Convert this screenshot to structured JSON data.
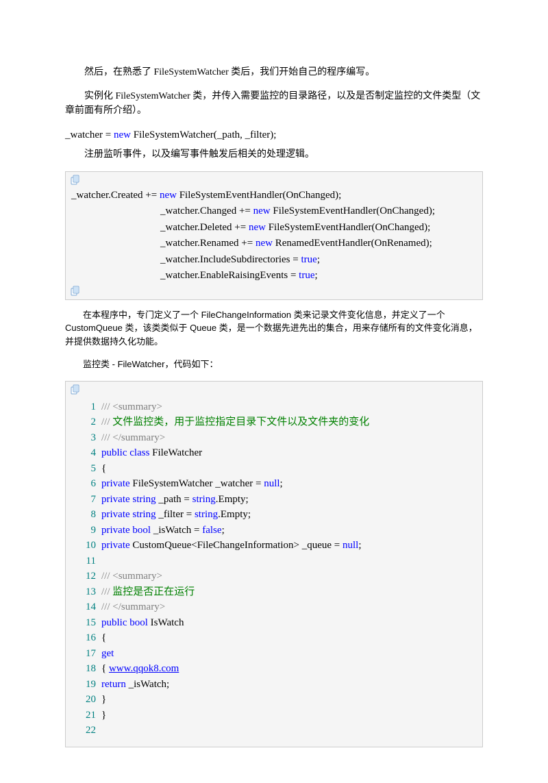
{
  "p1": "然后，在熟悉了 FileSystemWatcher 类后，我们开始自己的程序编写。",
  "p2": "实例化 FileSystemWatcher 类，并传入需要监控的目录路径，以及是否制定监控的文件类型（文章前面有所介绍）。",
  "p3": "注册监听事件，以及编写事件触发后相关的处理逻辑。",
  "p4a": "在本程序中，专门定义了一个 ",
  "p4b": " 类来记录文件变化信息，并定义了一个 ",
  "p4c": " 类，该类类似于 ",
  "p4d": " 类，是一个数据先进先出的集合，用来存储所有的文件变化消息，并提供数据持久化功能。",
  "term1": "FileChangeInformation",
  "term2": "CustomQueue",
  "term3": "Queue",
  "p5a": "监控类 - ",
  "p5b": "FileWatcher",
  "p5c": "，代码如下：",
  "code1": {
    "pre": "_watcher = ",
    "kw": "new",
    "post": " FileSystemWatcher(_path, _filter);"
  },
  "code2": {
    "l1a": "_watcher.Created += ",
    "l1b": "new",
    "l1c": " FileSystemEventHandler(OnChanged);",
    "l2a": "_watcher.Changed += ",
    "l2b": "new",
    "l2c": " FileSystemEventHandler(OnChanged);",
    "l3a": "_watcher.Deleted += ",
    "l3b": "new",
    "l3c": " FileSystemEventHandler(OnChanged);",
    "l4a": "_watcher.Renamed += ",
    "l4b": "new",
    "l4c": " RenamedEventHandler(OnRenamed);",
    "l5a": "_watcher.IncludeSubdirectories = ",
    "l5b": "true",
    "l5c": ";",
    "l6a": "_watcher.EnableRaisingEvents = ",
    "l6b": "true",
    "l6c": ";"
  },
  "code3": {
    "n1": "1",
    "n2": "2",
    "n3": "3",
    "n4": "4",
    "n5": "5",
    "n6": "6",
    "n7": "7",
    "n8": "8",
    "n9": "9",
    "n10": "10",
    "n11": "11",
    "n12": "12",
    "n13": "13",
    "n14": "14",
    "n15": "15",
    "n16": "16",
    "n17": "17",
    "n18": "18",
    "n19": "19",
    "n20": "20",
    "n21": "21",
    "n22": "22",
    "r1": "/// <summary>",
    "r2a": "/// ",
    "r2b": "文件监控类，用于监控指定目录下文件以及文件夹的变化",
    "r3": "/// </summary>",
    "r4a": "public",
    "r4b": " class",
    "r4c": " FileWatcher",
    "r5": "{",
    "r6a": "private",
    "r6b": " FileSystemWatcher _watcher = ",
    "r6c": "null",
    "r6d": ";",
    "r7a": "private",
    "r7b": " string",
    "r7c": " _path = ",
    "r7d": "string",
    "r7e": ".Empty;",
    "r8a": "private",
    "r8b": " string",
    "r8c": " _filter = ",
    "r8d": "string",
    "r8e": ".Empty;",
    "r9a": "private",
    "r9b": " bool",
    "r9c": " _isWatch = ",
    "r9d": "false",
    "r9e": ";",
    "r10a": "private",
    "r10b": " CustomQueue<FileChangeInformation> _queue = ",
    "r10c": "null",
    "r10d": ";",
    "r12": "/// <summary>",
    "r13a": "/// ",
    "r13b": "监控是否正在运行",
    "r14": "/// </summary>",
    "r15a": "public",
    "r15b": " bool",
    "r15c": " IsWatch",
    "r16": "{",
    "r17": "get",
    "r18a": "{ ",
    "r18b": "www.qqok8.com",
    "r19a": "return",
    "r19b": " _isWatch;",
    "r20": "}",
    "r21": "}"
  }
}
